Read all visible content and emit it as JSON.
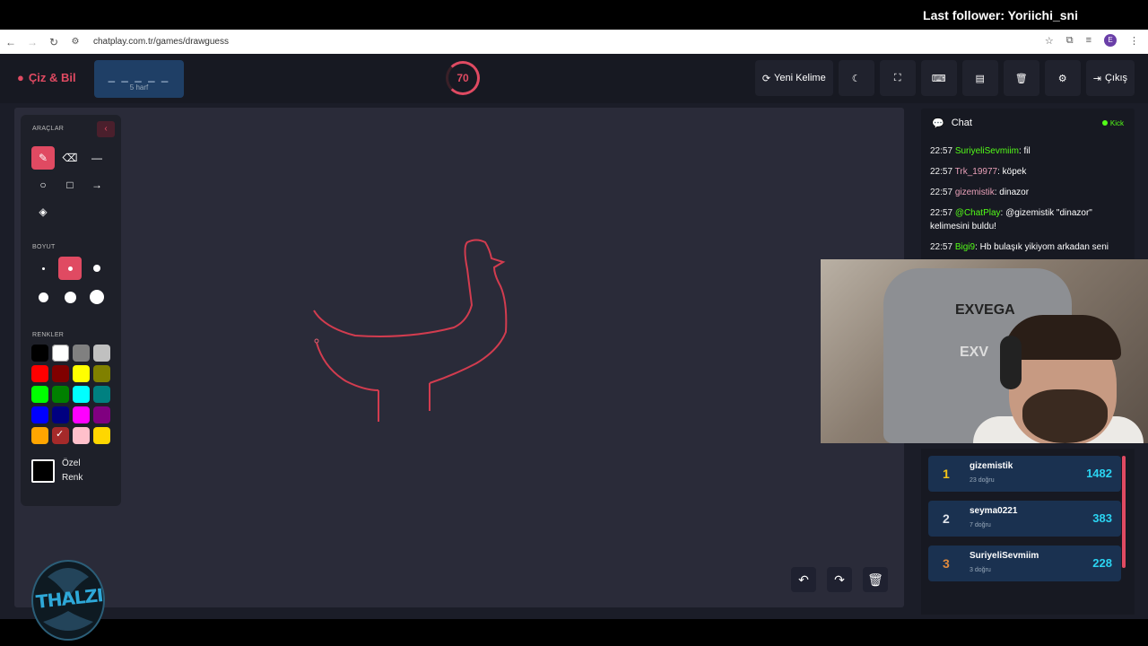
{
  "stream": {
    "last_follower": "Last follower: Yoriichi_sni"
  },
  "browser": {
    "url": "chatplay.com.tr/games/drawguess",
    "profile_initial": "E"
  },
  "header": {
    "logo": "Çiz & Bil",
    "word_hint": "_ _ _ _ _",
    "word_length": "5 harf",
    "timer": "70",
    "buttons": {
      "new_word": "Yeni Kelime",
      "exit": "Çıkış"
    }
  },
  "tools": {
    "section_tools": "ARAÇLAR",
    "section_size": "BOYUT",
    "section_colors": "RENKLER",
    "custom_color_line1": "Özel",
    "custom_color_line2": "Renk",
    "colors": [
      "#000000",
      "#ffffff",
      "#808080",
      "#c0c0c0",
      "#ff0000",
      "#800000",
      "#ffff00",
      "#808000",
      "#00ff00",
      "#008000",
      "#00ffff",
      "#008080",
      "#0000ff",
      "#000080",
      "#ff00ff",
      "#800080",
      "#ffa500",
      "#a52a2a",
      "#ffc0cb",
      "#ffd700"
    ],
    "selected_color": "#a52a2a"
  },
  "chat": {
    "title": "Chat",
    "platform": "Kick",
    "messages": [
      {
        "time": "22:57",
        "user": "SuriyeliSevmiim",
        "user_color": "#53fc18",
        "text": ": fil"
      },
      {
        "time": "22:57",
        "user": "Trk_19977",
        "user_color": "#e8a0b8",
        "text": ": köpek"
      },
      {
        "time": "22:57",
        "user": "gizemistik",
        "user_color": "#e8a0b8",
        "text": ": dinazor"
      },
      {
        "time": "22:57",
        "user": "@ChatPlay",
        "user_color": "#53fc18",
        "text": ": @gizemistik \"dinazor\" kelimesini buldu!"
      },
      {
        "time": "22:57",
        "user": "Bigi9",
        "user_color": "#53fc18",
        "text": ": Hb bulaşık yikiyom arkadan seni"
      }
    ]
  },
  "leaderboard": [
    {
      "rank": "1",
      "name": "gizemistik",
      "sub": "23 doğru",
      "score": "1482",
      "rank_color": "#f5c518"
    },
    {
      "rank": "2",
      "name": "seyma0221",
      "sub": "7 doğru",
      "score": "383",
      "rank_color": "#dfe3ea"
    },
    {
      "rank": "3",
      "name": "SuriyeliSevmiim",
      "sub": "3 doğru",
      "score": "228",
      "rank_color": "#e08a3c"
    }
  ],
  "webcam": {
    "chair_brand": "EXVEGA",
    "chair_brand2": "EXV"
  },
  "badge": {
    "text": "THALZI"
  },
  "accent": "#e04a62"
}
